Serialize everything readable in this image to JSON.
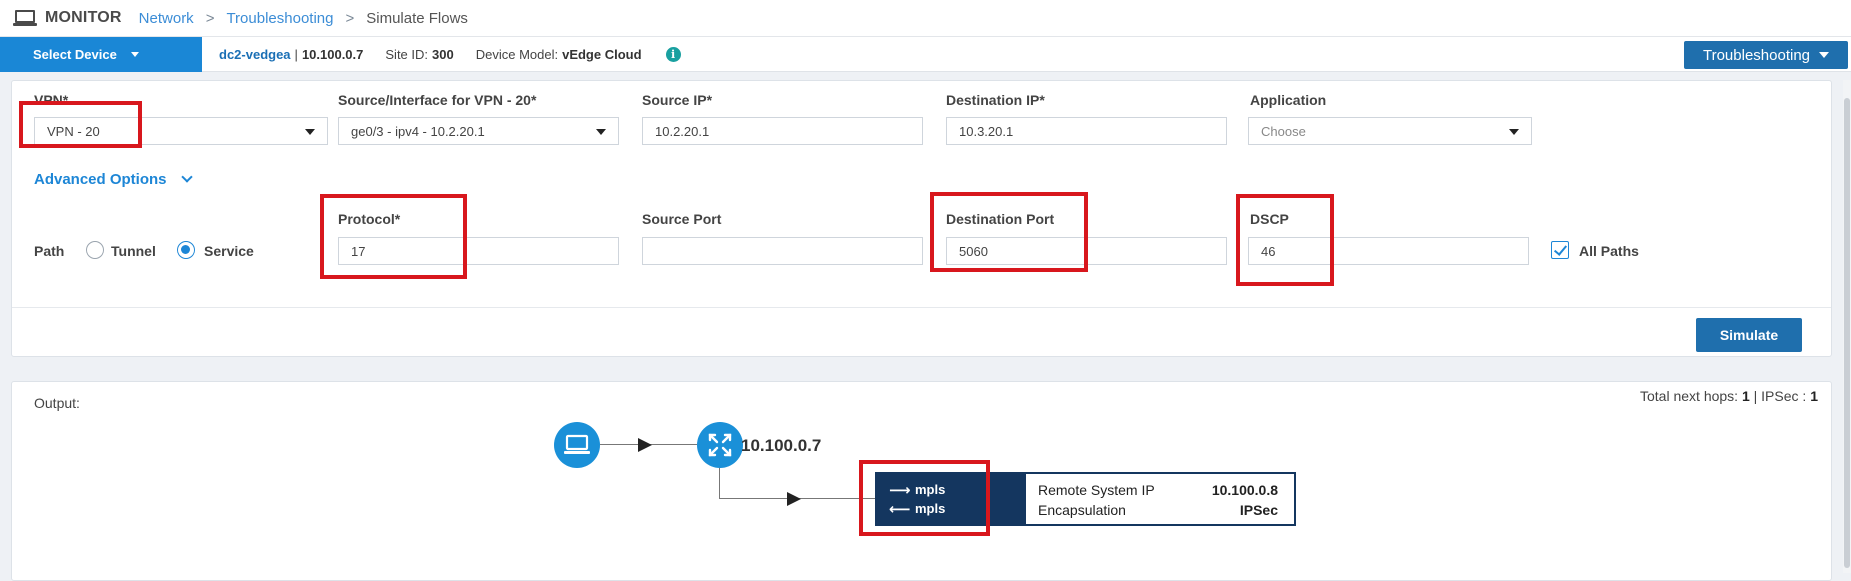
{
  "topbar": {
    "title": "MONITOR",
    "breadcrumbs": [
      "Network",
      "Troubleshooting"
    ],
    "current": "Simulate Flows",
    "separator": ">"
  },
  "devicebar": {
    "select_device_label": "Select Device",
    "hostname": "dc2-vedgea",
    "system_ip": "10.100.0.7",
    "site_id_label": "Site ID:",
    "site_id": "300",
    "model_label": "Device Model:",
    "model": "vEdge Cloud",
    "info_glyph": "i",
    "troubleshooting_label": "Troubleshooting"
  },
  "form": {
    "vpn": {
      "label": "VPN*",
      "value": "VPN - 20"
    },
    "source_interface": {
      "label": "Source/Interface for VPN - 20*",
      "value": "ge0/3 - ipv4 - 10.2.20.1"
    },
    "source_ip": {
      "label": "Source IP*",
      "value": "10.2.20.1"
    },
    "destination_ip": {
      "label": "Destination IP*",
      "value": "10.3.20.1"
    },
    "application": {
      "label": "Application",
      "placeholder": "Choose"
    },
    "advanced_options_label": "Advanced Options",
    "path": {
      "label": "Path",
      "options": [
        {
          "label": "Tunnel",
          "selected": false
        },
        {
          "label": "Service",
          "selected": true
        }
      ]
    },
    "protocol": {
      "label": "Protocol*",
      "value": "17"
    },
    "source_port": {
      "label": "Source Port",
      "value": ""
    },
    "destination_port": {
      "label": "Destination Port",
      "value": "5060"
    },
    "dscp": {
      "label": "DSCP",
      "value": "46"
    },
    "all_paths": {
      "label": "All Paths",
      "checked": true
    },
    "simulate_label": "Simulate"
  },
  "output": {
    "label": "Output:",
    "hops_label": "Total next hops:",
    "hops": "1",
    "ipsec_label": "IPSec :",
    "ipsec": "1",
    "router_ip": "10.100.0.7",
    "tunnel": {
      "out_color": "mpls",
      "in_color": "mpls",
      "remote_ip_label": "Remote System IP",
      "remote_ip": "10.100.0.8",
      "encap_label": "Encapsulation",
      "encap": "IPSec"
    }
  },
  "colors": {
    "accent": "#1a87d6",
    "button": "#1f6fad",
    "tunnel": "#14365f",
    "highlight": "#d8171d"
  }
}
